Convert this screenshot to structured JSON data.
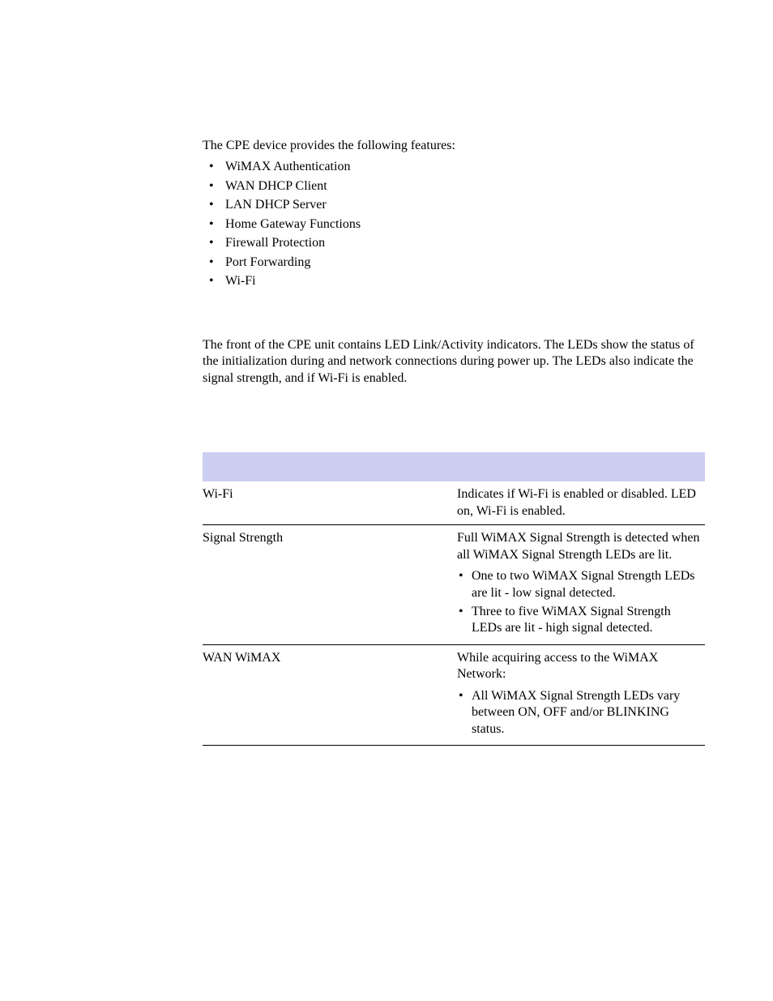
{
  "intro": "The CPE device provides the following features:",
  "features": [
    "WiMAX Authentication",
    "WAN DHCP Client",
    "LAN DHCP Server",
    "Home Gateway Functions",
    "Firewall Protection",
    "Port Forwarding",
    "Wi-Fi"
  ],
  "front_desc": "The front of the CPE unit contains LED Link/Activity indicators. The LEDs show the status of the initialization during and network connections during power up. The LEDs also indicate the signal strength, and if Wi-Fi is enabled.",
  "table": {
    "header_left": "",
    "header_right": "",
    "rows": [
      {
        "name": "Wi-Fi",
        "para": "Indicates if Wi-Fi is enabled or disabled. LED on, Wi-Fi is enabled.",
        "bullets": []
      },
      {
        "name": "Signal Strength",
        "para": "Full WiMAX Signal Strength is detected when all WiMAX Signal Strength LEDs are lit.",
        "bullets": [
          "One to two WiMAX Signal Strength LEDs are lit - low signal detected.",
          "Three to five WiMAX Signal Strength LEDs are lit - high signal detected."
        ]
      },
      {
        "name": "WAN WiMAX",
        "para": "While acquiring access to the WiMAX Network:",
        "bullets": [
          "All WiMAX Signal Strength LEDs vary between ON, OFF and/or BLINKING status."
        ]
      }
    ]
  }
}
